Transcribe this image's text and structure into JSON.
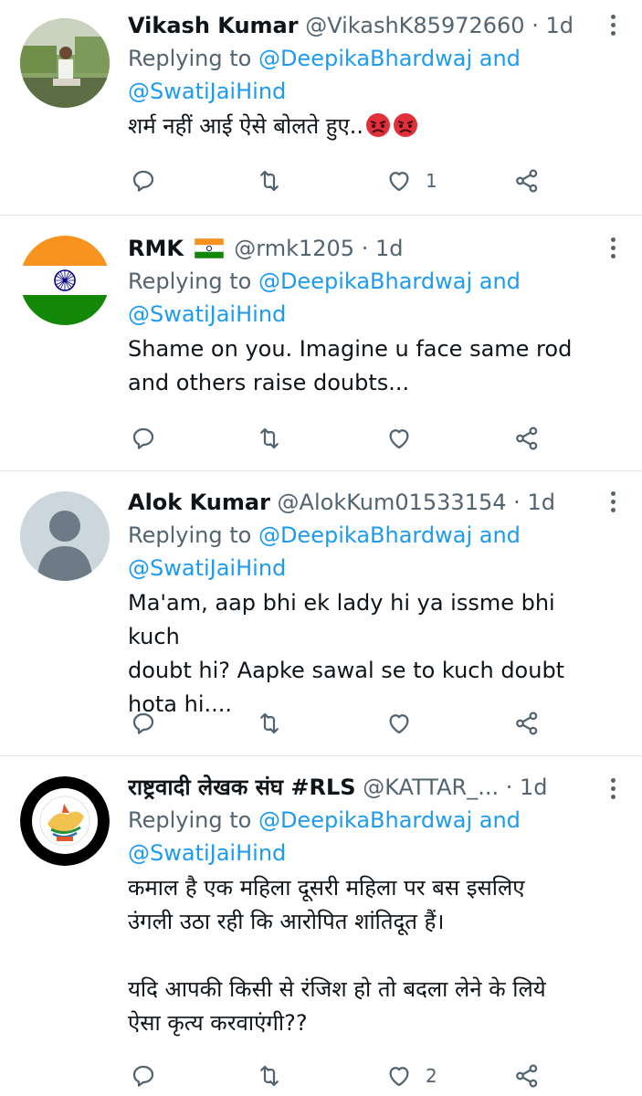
{
  "tweets": [
    {
      "name": "Vikash Kumar",
      "handle": "@VikashK85972660",
      "dot": "·",
      "time": "1d",
      "replying_prefix": "Replying to",
      "mention1": "@DeepikaBhardwaj",
      "and": "and",
      "mention2": "@SwatiJaiHind",
      "text": "शर्म नहीं आई ऐसे बोलते हुए..",
      "emojis": [
        "angry-face-icon",
        "angry-face-icon"
      ],
      "likes": "1"
    },
    {
      "name": "RMK",
      "flag": "india-flag-icon",
      "handle": "@rmk1205",
      "dot": "·",
      "time": "1d",
      "replying_prefix": "Replying to",
      "mention1": "@DeepikaBhardwaj",
      "and": "and",
      "mention2": "@SwatiJaiHind",
      "text": "Shame on you. Imagine u face same rod\nand others raise doubts...",
      "likes": ""
    },
    {
      "name": "Alok Kumar",
      "handle": "@AlokKum01533154",
      "dot": "·",
      "time": "1d",
      "replying_prefix": "Replying to",
      "mention1": "@DeepikaBhardwaj",
      "and": "and",
      "mention2": "@SwatiJaiHind",
      "text": "Ma'am, aap bhi ek lady hi ya issme bhi kuch\ndoubt hi? Aapke sawal se to kuch doubt\nhota hi....",
      "likes": ""
    },
    {
      "name": "राष्ट्रवादी लेखक संघ #RLS",
      "handle": "@KATTAR_...",
      "dot": "·",
      "time": "1d",
      "replying_prefix": "Replying to",
      "mention1": "@DeepikaBhardwaj",
      "and": "and",
      "mention2": "@SwatiJaiHind",
      "text": "कमाल है एक महिला दूसरी महिला पर बस इसलिए\nउंगली उठा रही कि आरोपित शांतिदूत हैं।\n\nयदि आपकी किसी से रंजिश हो तो बदला लेने के लिये\nऐसा कृत्य करवाएंगी??",
      "likes": "2"
    }
  ],
  "colors": {
    "link": "#1d9bf0",
    "muted": "#536471",
    "text": "#0f1419",
    "divider": "#e4e8eb"
  }
}
